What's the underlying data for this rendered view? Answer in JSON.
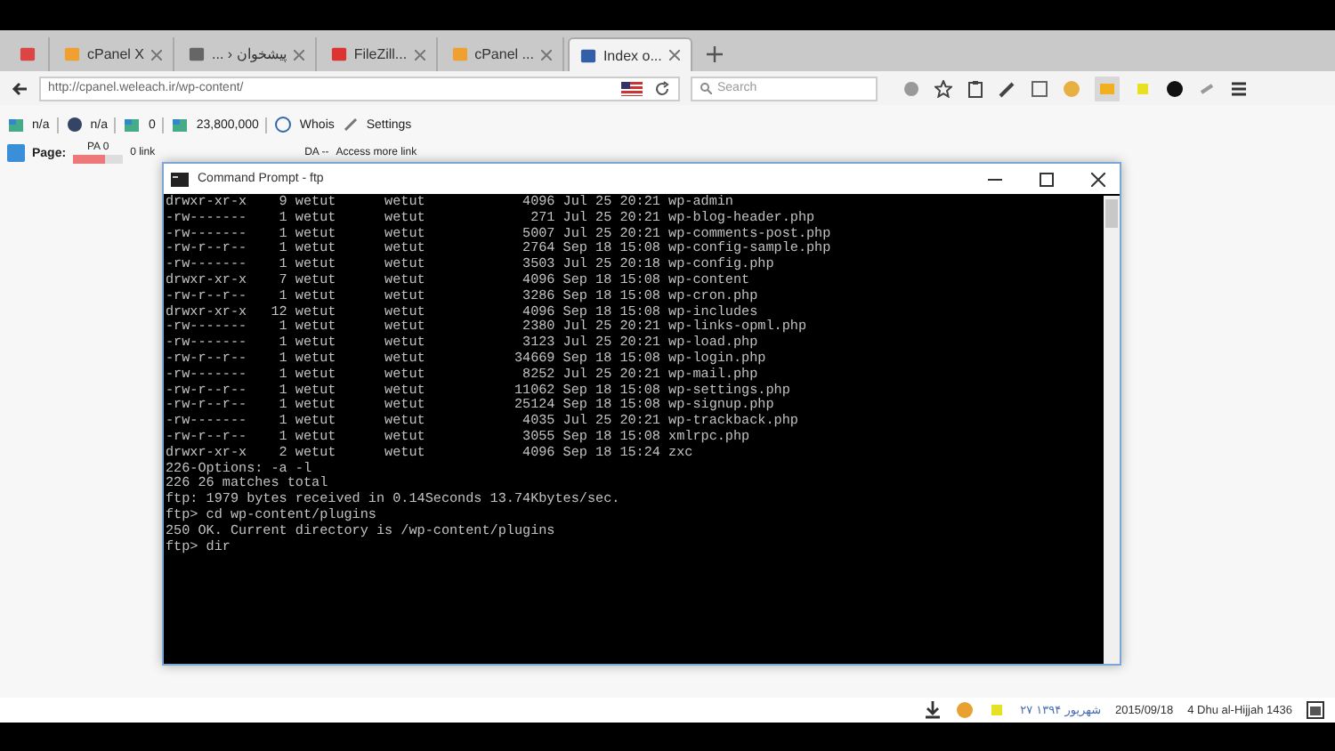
{
  "tabs": [
    {
      "kind": "pinned",
      "selected": false
    },
    {
      "kind": "tab",
      "label": "cPanel X",
      "selected": false
    },
    {
      "kind": "tab",
      "label": "پیشخوان ‹ ...",
      "selected": false
    },
    {
      "kind": "tab",
      "label": "FileZill...",
      "selected": false
    },
    {
      "kind": "tab",
      "label": "cPanel ...",
      "selected": false
    },
    {
      "kind": "tab",
      "label": "Index o...",
      "selected": true
    }
  ],
  "address_bar": {
    "value": "http://cpanel.weleach.ir/wp-content/"
  },
  "search": {
    "placeholder": "Search"
  },
  "seo_bar": {
    "items": [
      "n/a",
      "n/a",
      "0",
      "23,800,000"
    ],
    "whois": "Whois",
    "settings": "Settings"
  },
  "page_bar": {
    "label": "Page:",
    "pa": "PA 0",
    "level": 0.65,
    "links": "0 link",
    "da": "DA --",
    "access": "Access more link"
  },
  "window": {
    "title": "Command Prompt - ftp"
  },
  "terminal": {
    "lines": [
      "drwxr-xr-x    9 wetut      wetut            4096 Jul 25 20:21 wp-admin",
      "-rw-------    1 wetut      wetut             271 Jul 25 20:21 wp-blog-header.php",
      "-rw-------    1 wetut      wetut            5007 Jul 25 20:21 wp-comments-post.php",
      "-rw-r--r--    1 wetut      wetut            2764 Sep 18 15:08 wp-config-sample.php",
      "-rw-------    1 wetut      wetut            3503 Jul 25 20:18 wp-config.php",
      "drwxr-xr-x    7 wetut      wetut            4096 Sep 18 15:08 wp-content",
      "-rw-r--r--    1 wetut      wetut            3286 Sep 18 15:08 wp-cron.php",
      "drwxr-xr-x   12 wetut      wetut            4096 Sep 18 15:08 wp-includes",
      "-rw-------    1 wetut      wetut            2380 Jul 25 20:21 wp-links-opml.php",
      "-rw-------    1 wetut      wetut            3123 Jul 25 20:21 wp-load.php",
      "-rw-r--r--    1 wetut      wetut           34669 Sep 18 15:08 wp-login.php",
      "-rw-------    1 wetut      wetut            8252 Jul 25 20:21 wp-mail.php",
      "-rw-r--r--    1 wetut      wetut           11062 Sep 18 15:08 wp-settings.php",
      "-rw-r--r--    1 wetut      wetut           25124 Sep 18 15:08 wp-signup.php",
      "-rw-------    1 wetut      wetut            4035 Jul 25 20:21 wp-trackback.php",
      "-rw-r--r--    1 wetut      wetut            3055 Sep 18 15:08 xmlrpc.php",
      "drwxr-xr-x    2 wetut      wetut            4096 Sep 18 15:24 zxc",
      "226-Options: -a -l",
      "226 26 matches total",
      "ftp: 1979 bytes received in 0.14Seconds 13.74Kbytes/sec.",
      "ftp> cd wp-content/plugins",
      "250 OK. Current directory is /wp-content/plugins",
      "ftp> dir"
    ]
  },
  "taskbar": {
    "persian_date": "۲۷ شهریور ۱۳۹۴",
    "date": "2015/09/18",
    "hijri": "4 Dhu al-Hijjah 1436"
  }
}
